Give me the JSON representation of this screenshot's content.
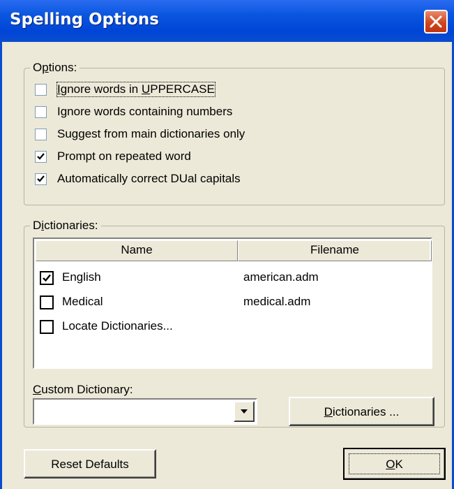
{
  "window": {
    "title": "Spelling Options"
  },
  "options_group": {
    "legend_pre": "O",
    "legend_ul": "p",
    "legend_post": "tions:",
    "checkboxes": [
      {
        "label_pre": "",
        "label_ul": "I",
        "label_post": "gnore words in ",
        "label_ul2": "U",
        "label_post2": "PPERCASE",
        "checked": false
      },
      {
        "label": "Ignore words containing numbers",
        "checked": false
      },
      {
        "label": "Suggest from main dictionaries only",
        "checked": false
      },
      {
        "label": "Prompt on repeated word",
        "checked": true
      },
      {
        "label": "Automatically correct DUal capitals",
        "checked": true
      }
    ]
  },
  "dictionaries_group": {
    "legend_pre": "D",
    "legend_ul": "i",
    "legend_post": "ctionaries:",
    "columns": [
      "Name",
      "Filename"
    ],
    "rows": [
      {
        "name": "English",
        "filename": "american.adm",
        "checked": true
      },
      {
        "name": "Medical",
        "filename": "medical.adm",
        "checked": false
      },
      {
        "name": "Locate Dictionaries...",
        "filename": "",
        "checked": false
      }
    ],
    "custom_label_ul": "C",
    "custom_label_post": "ustom Dictionary:",
    "custom_value": "",
    "dictionaries_button_ul": "D",
    "dictionaries_button_post": "ictionaries ..."
  },
  "buttons": {
    "reset": "Reset Defaults",
    "ok_ul": "O",
    "ok_post": "K"
  }
}
